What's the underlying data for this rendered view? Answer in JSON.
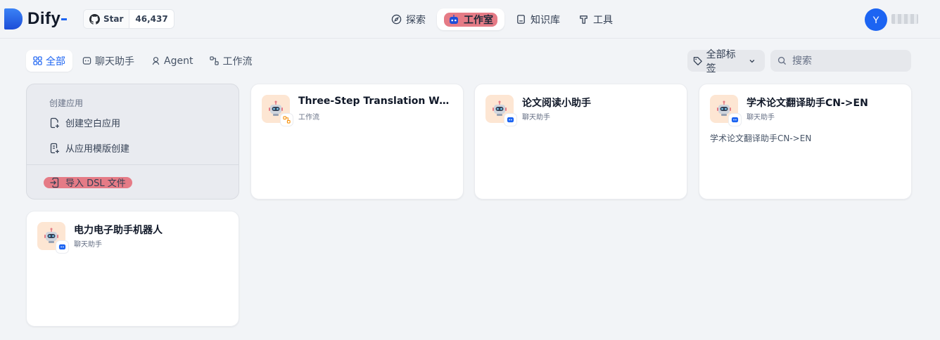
{
  "brand": {
    "name": "Dify"
  },
  "github": {
    "star_label": "Star",
    "star_count": "46,437"
  },
  "nav": {
    "items": [
      {
        "label": "探索",
        "icon": "compass-icon"
      },
      {
        "label": "工作室",
        "icon": "robot-icon",
        "active": true
      },
      {
        "label": "知识库",
        "icon": "book-icon"
      },
      {
        "label": "工具",
        "icon": "hammer-icon"
      }
    ]
  },
  "user": {
    "avatar_initial": "Y"
  },
  "filters": {
    "tabs": [
      {
        "label": "全部",
        "icon": "grid-icon",
        "active": true
      },
      {
        "label": "聊天助手",
        "icon": "chat-icon"
      },
      {
        "label": "Agent",
        "icon": "agent-icon"
      },
      {
        "label": "工作流",
        "icon": "workflow-icon"
      }
    ],
    "tag_label": "全部标签",
    "search_placeholder": "搜索"
  },
  "create": {
    "title": "创建应用",
    "blank_label": "创建空白应用",
    "template_label": "从应用模版创建",
    "import_label": "导入 DSL 文件"
  },
  "apps": [
    {
      "name": "Three-Step Translation Workflow",
      "type": "工作流",
      "badge": "workflow-icon",
      "desc": ""
    },
    {
      "name": "论文阅读小助手",
      "type": "聊天助手",
      "badge": "chat-bubble-icon",
      "desc": ""
    },
    {
      "name": "学术论文翻译助手CN->EN",
      "type": "聊天助手",
      "badge": "chat-bubble-icon",
      "desc": "学术论文翻译助手CN->EN"
    },
    {
      "name": "电力电子助手机器人",
      "type": "聊天助手",
      "badge": "chat-bubble-icon",
      "desc": ""
    }
  ],
  "colors": {
    "accent": "#1c64f2",
    "highlight": "#e57b86",
    "app_icon_bg": "#fde6d3"
  }
}
